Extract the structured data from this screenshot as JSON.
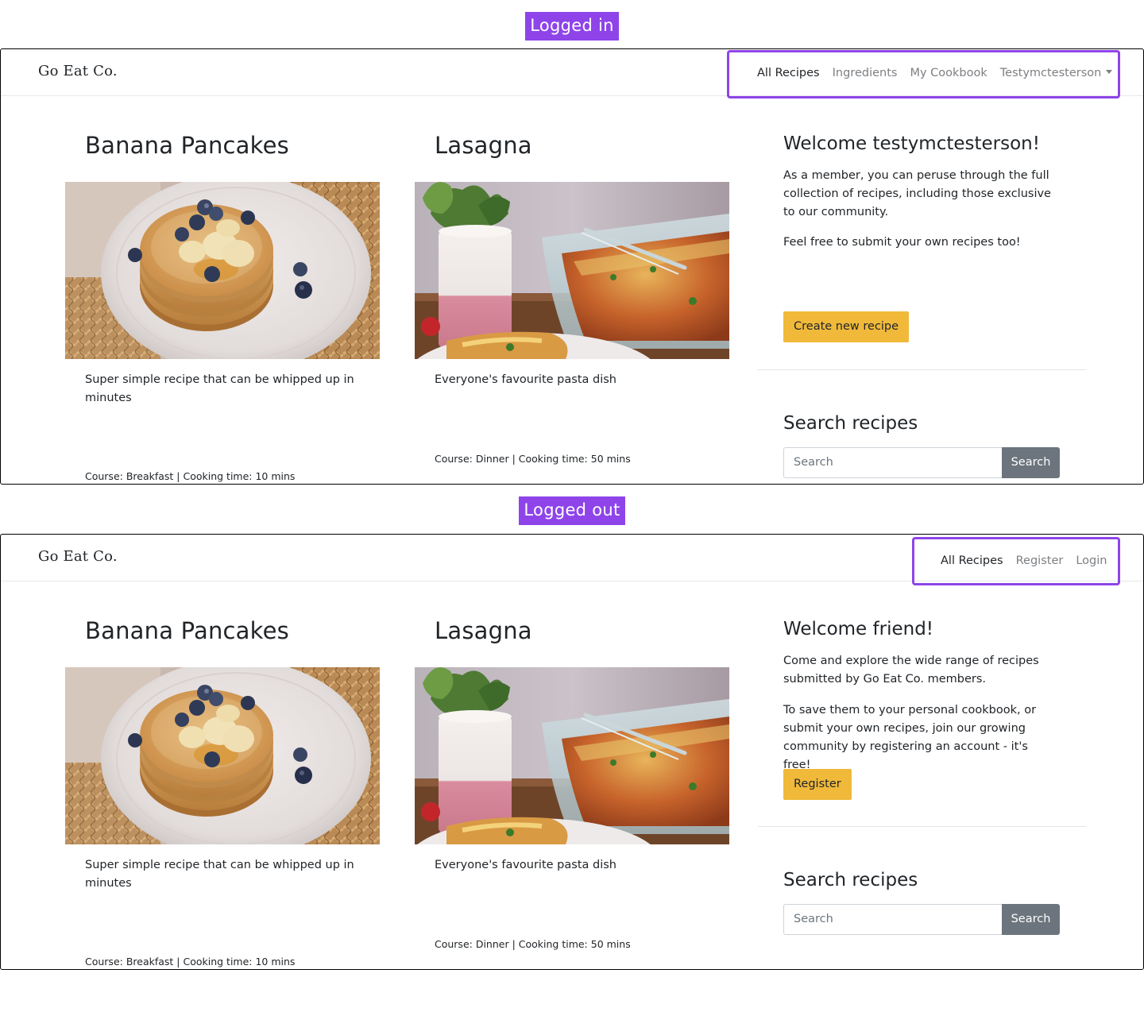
{
  "labels": {
    "logged_in": "Logged in",
    "logged_out": "Logged out"
  },
  "colors": {
    "accent": "#8e44e9",
    "button_yellow": "#f0b93a",
    "button_grey": "#6c757d"
  },
  "logged_in": {
    "brand": "Go Eat Co.",
    "nav": {
      "all_recipes": "All Recipes",
      "ingredients": "Ingredients",
      "my_cookbook": "My Cookbook",
      "user": "Testymctesterson"
    },
    "recipes": [
      {
        "title": "Banana Pancakes",
        "description": "Super simple recipe that can be whipped up in minutes",
        "meta": "Course: Breakfast | Cooking time: 10 mins",
        "image": "pancakes-photo"
      },
      {
        "title": "Lasagna",
        "description": "Everyone's favourite pasta dish",
        "meta": "Course: Dinner | Cooking time: 50 mins",
        "image": "lasagna-photo"
      }
    ],
    "welcome": {
      "title": "Welcome testymctesterson!",
      "paragraph1": "As a member, you can peruse through the full collection of recipes, including those exclusive to our community.",
      "paragraph2": "Feel free to submit your own recipes too!",
      "button": "Create new recipe"
    },
    "search": {
      "title": "Search recipes",
      "placeholder": "Search",
      "button": "Search"
    }
  },
  "logged_out": {
    "brand": "Go Eat Co.",
    "nav": {
      "all_recipes": "All Recipes",
      "register": "Register",
      "login": "Login"
    },
    "recipes": [
      {
        "title": "Banana Pancakes",
        "description": "Super simple recipe that can be whipped up in minutes",
        "meta": "Course: Breakfast | Cooking time: 10 mins",
        "image": "pancakes-photo"
      },
      {
        "title": "Lasagna",
        "description": "Everyone's favourite pasta dish",
        "meta": "Course: Dinner | Cooking time: 50 mins",
        "image": "lasagna-photo"
      }
    ],
    "welcome": {
      "title": "Welcome friend!",
      "paragraph1": "Come and explore the wide range of recipes submitted by Go Eat Co. members.",
      "paragraph2": "To save them to your personal cookbook, or submit your own recipes, join our growing community by registering an account - it's free!",
      "button": "Register"
    },
    "search": {
      "title": "Search recipes",
      "placeholder": "Search",
      "button": "Search"
    }
  }
}
